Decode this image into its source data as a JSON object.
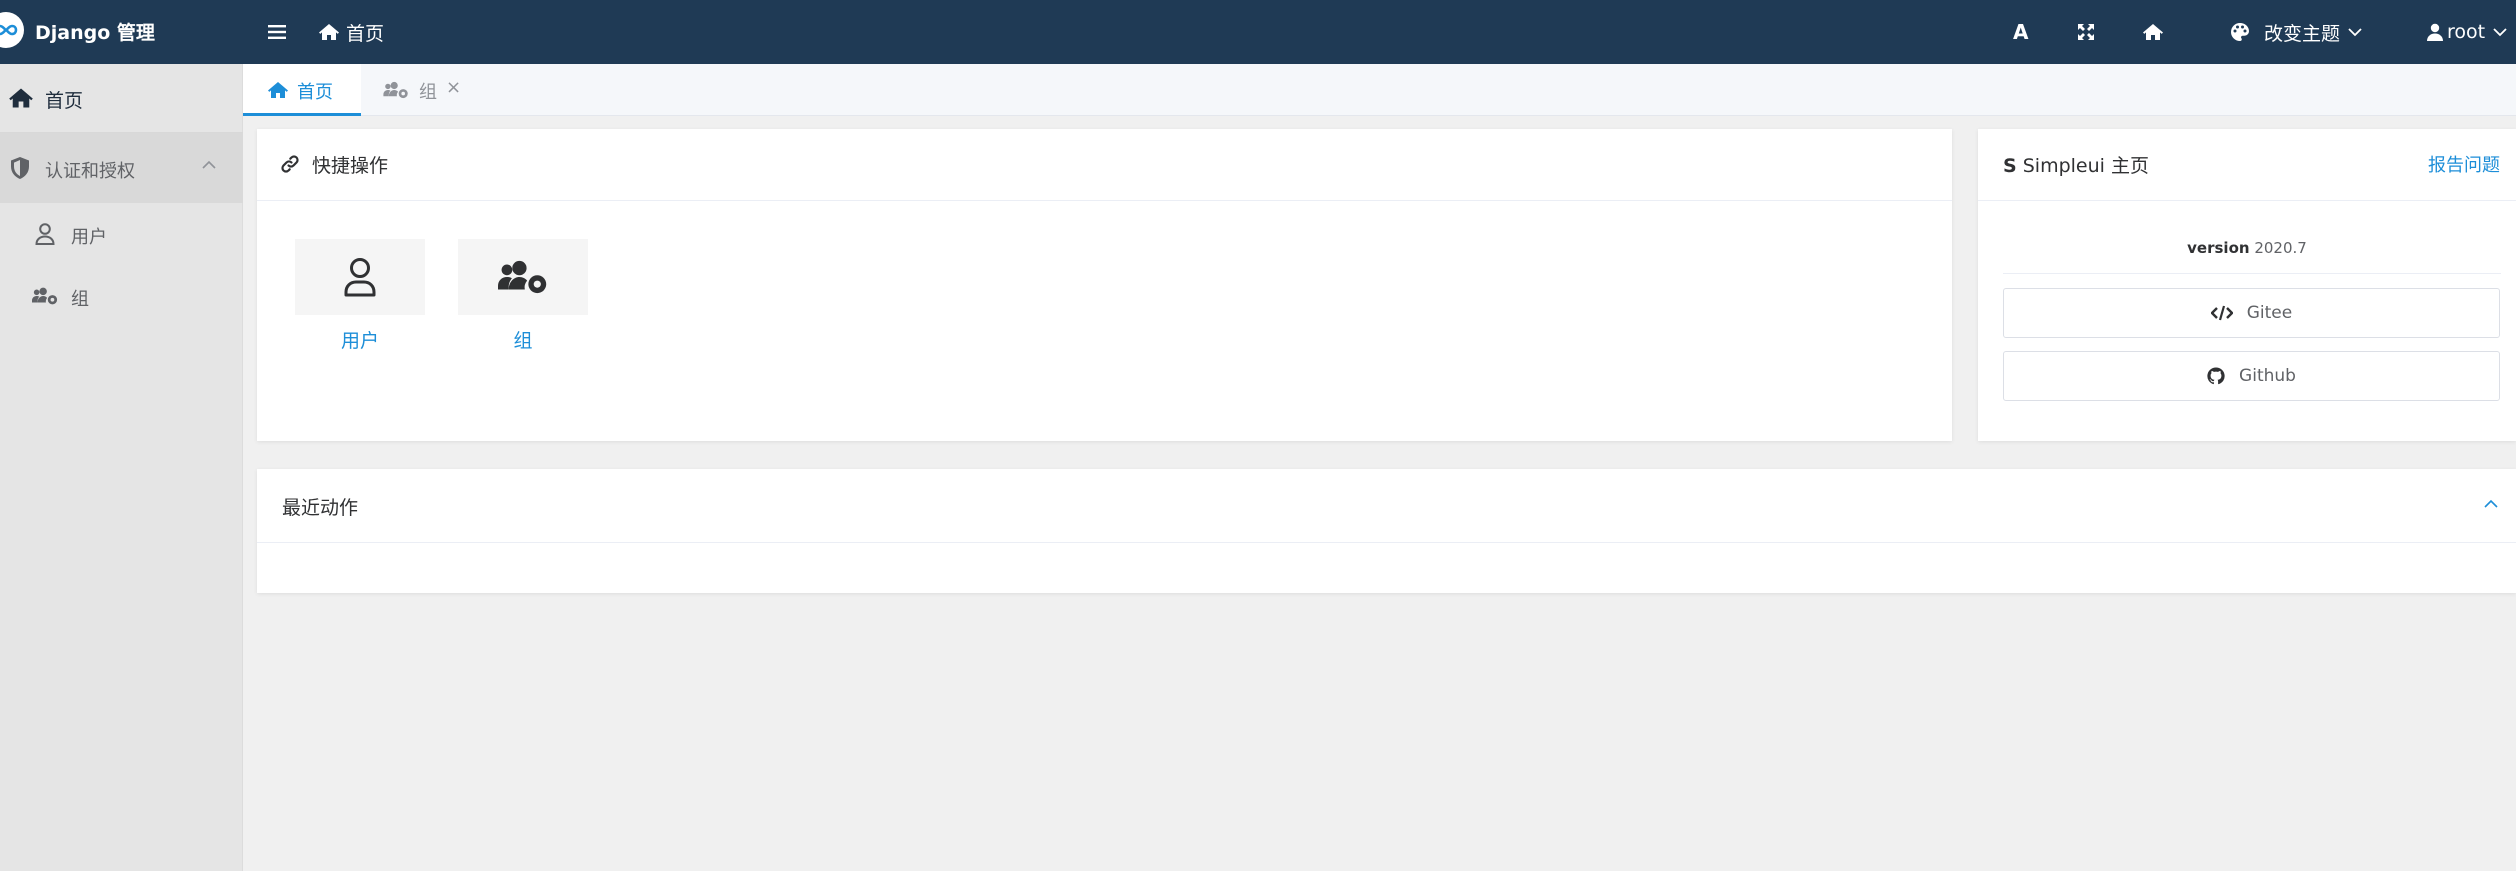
{
  "header": {
    "app_title": "Django 管理",
    "breadcrumb_home": "首页",
    "theme_label": "改变主题",
    "user_name": "root",
    "font_icon": "A"
  },
  "sidebar": {
    "items": [
      {
        "label": "首页",
        "icon": "home-icon"
      },
      {
        "label": "认证和授权",
        "icon": "shield-icon",
        "expanded": true
      },
      {
        "label": "用户",
        "icon": "user-icon"
      },
      {
        "label": "组",
        "icon": "users-cog-icon"
      }
    ]
  },
  "tabs": [
    {
      "label": "首页",
      "active": true
    },
    {
      "label": "组",
      "close": "×"
    }
  ],
  "quick_actions": {
    "title": "快捷操作",
    "items": [
      {
        "label": "用户",
        "icon": "user-icon"
      },
      {
        "label": "组",
        "icon": "users-cog-icon"
      }
    ]
  },
  "simpleui": {
    "title_prefix": "S",
    "title": "Simpleui 主页",
    "report_link": "报告问题",
    "version_label": "version",
    "version_value": "2020.7",
    "gitee_label": "Gitee",
    "github_label": "Github"
  },
  "recent_actions": {
    "title": "最近动作"
  },
  "colors": {
    "topbar": "#1f3a55",
    "accent": "#1d8ed8",
    "sidebar_bg": "#e5e5e5",
    "content_bg": "#f0f0f0"
  }
}
